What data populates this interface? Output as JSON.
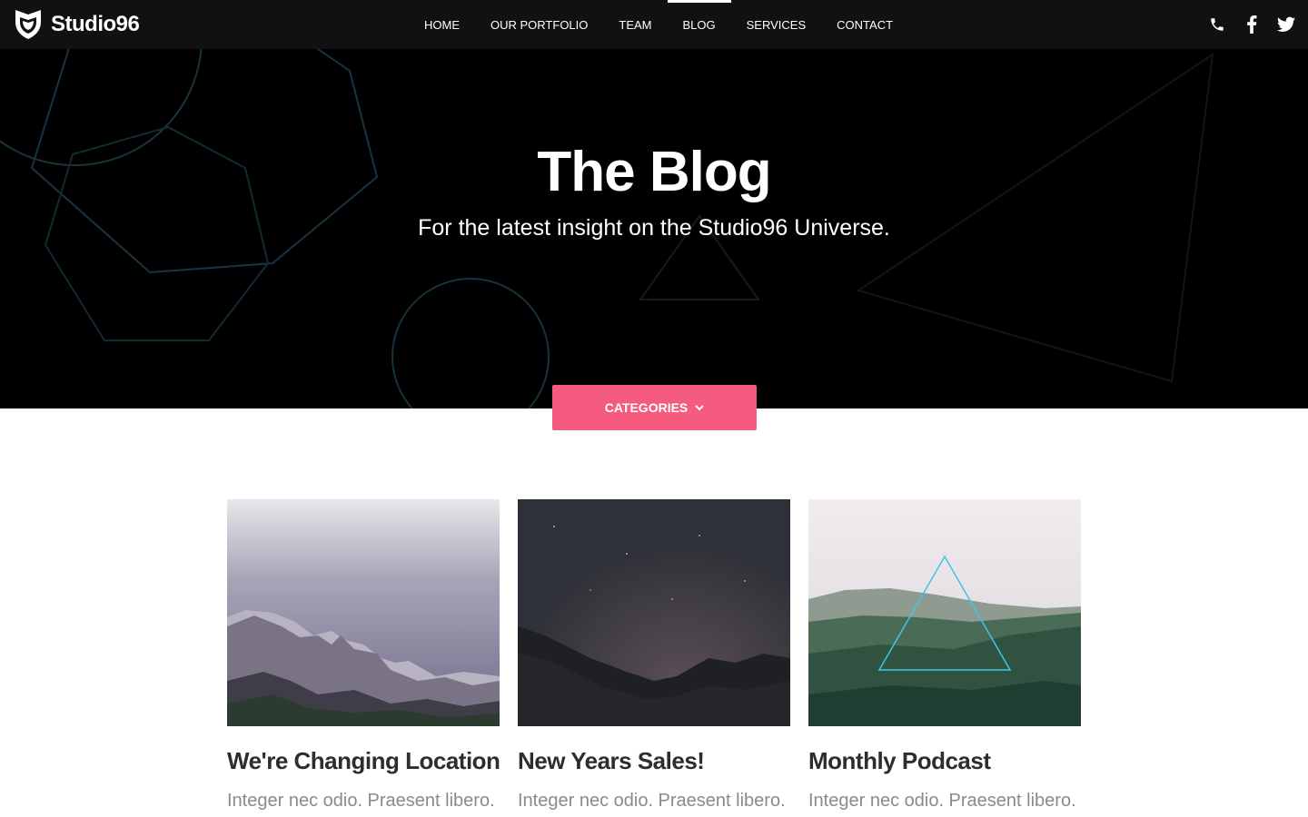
{
  "brand": {
    "name": "Studio96"
  },
  "nav": {
    "items": [
      {
        "label": "HOME"
      },
      {
        "label": "OUR PORTFOLIO"
      },
      {
        "label": "TEAM"
      },
      {
        "label": "BLOG"
      },
      {
        "label": "SERVICES"
      },
      {
        "label": "CONTACT"
      }
    ],
    "active": "BLOG"
  },
  "social": {
    "icons": [
      "phone-icon",
      "facebook-icon",
      "twitter-icon"
    ]
  },
  "hero": {
    "title": "The Blog",
    "subtitle": "For the latest insight on the Studio96 Universe."
  },
  "categories_button": {
    "label": "CATEGORIES",
    "icon": "chevron-down-icon"
  },
  "posts": [
    {
      "title": "We're Changing Location",
      "excerpt": "Integer nec odio. Praesent libero."
    },
    {
      "title": "New Years Sales!",
      "excerpt": "Integer nec odio. Praesent libero."
    },
    {
      "title": "Monthly Podcast",
      "excerpt": "Integer nec odio. Praesent libero."
    }
  ],
  "colors": {
    "accent": "#f55a7f",
    "nav_bg": "#111111",
    "hero_bg": "#000000"
  }
}
